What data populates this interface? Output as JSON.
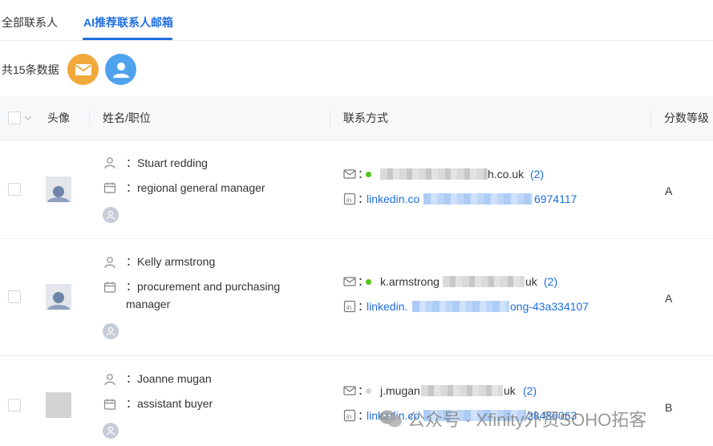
{
  "tabs": [
    {
      "label": "全部联系人",
      "active": false
    },
    {
      "label": "AI推荐联系人邮箱",
      "active": true
    }
  ],
  "toolbar": {
    "count_text": "共15条数据"
  },
  "table": {
    "headers": {
      "avatar": "头像",
      "name_title": "姓名/职位",
      "contact": "联系方式",
      "grade": "分数等级"
    },
    "rows": [
      {
        "name": "Stuart redding",
        "title_line1": "regional general manager",
        "title_line2": "",
        "email_end": "h.co.uk",
        "email_count": "(2)",
        "linkedin_start": "linkedin.co",
        "linkedin_end": "6974117",
        "grade": "A",
        "status": "green"
      },
      {
        "name": "Kelly armstrong",
        "title_line1": "procurement and purchasing",
        "title_line2": "manager",
        "email_start": "k.armstrong",
        "email_end": "uk",
        "email_count": "(2)",
        "linkedin_start": "linkedin.",
        "linkedin_end": "ong-43a334107",
        "grade": "A",
        "status": "green"
      },
      {
        "name": "Joanne mugan",
        "title_line1": "assistant buyer",
        "title_line2": "",
        "email_start": "j.mugan",
        "email_end": "uk",
        "email_count": "(2)",
        "linkedin_start": "linkedin.co",
        "linkedin_end": "28486063",
        "grade": "B",
        "status": "gray"
      }
    ]
  },
  "watermark": {
    "text": "公众号 · Xfinity外贸SOHO拓客"
  },
  "colors": {
    "accent": "#1f6fe0",
    "mail_button": "#f2a93b",
    "user_button": "#4fa3ee",
    "status_green": "#52c41a",
    "status_gray": "#d5d5d5"
  }
}
